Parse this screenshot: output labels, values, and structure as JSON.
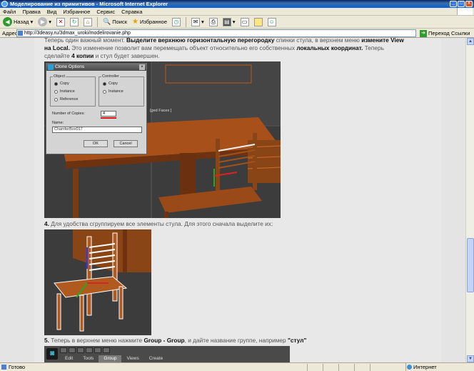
{
  "window": {
    "title": "Моделирование из примитивов - Microsoft Internet Explorer"
  },
  "menu": [
    "Файл",
    "Правка",
    "Вид",
    "Избранное",
    "Сервис",
    "Справка"
  ],
  "toolbar": {
    "back_label": "Назад",
    "search_label": "Поиск",
    "favorites_label": "Избранное"
  },
  "address": {
    "label": "Адрес:",
    "url": "http://3deasy.ru/3dmax_uroki/modelirovanie.php",
    "go_label": "Переход",
    "links_label": "Ссылки"
  },
  "article": {
    "p1_a": "Теперь один важный момент.",
    "p1_b": "Выделите верхнюю горизонтальную перегородку",
    "p1_c": "спинки стула, в верхнем меню",
    "p1_d": "измените View",
    "p2_a": "на Local.",
    "p2_b": "Это изменение позволит вам перемещать объект относительно его собственных",
    "p2_c": "локальных координат.",
    "p2_d": "Теперь",
    "p3_a": "сделайте",
    "p3_b": "4 копии",
    "p3_c": "и стул будет завершен.",
    "step4_num": "4.",
    "step4_text": "Для удобства сгруппируем все элементы стула. Для этого сначала выделите их:",
    "step5_num": "5.",
    "step5_a": "Теперь в верхнем меню нажмите",
    "step5_b": "Group - Group",
    "step5_c": ", и дайте название группе, например",
    "step5_d": "\"стул\""
  },
  "clone_dialog": {
    "title": "Clone Options",
    "object_label": "Object",
    "object_options": [
      "Copy",
      "Instance",
      "Reference"
    ],
    "controller_label": "Controller",
    "controller_options": [
      "Copy",
      "Instance"
    ],
    "copies_label": "Number of Copies:",
    "copies_value": "4",
    "name_label": "Name:",
    "name_value": "ChamferBox017",
    "ok_label": "OK",
    "cancel_label": "Cancel"
  },
  "viewport_label": "[ged Faces ]",
  "max_menu": [
    "Edit",
    "Tools",
    "Group",
    "Views",
    "Create"
  ],
  "max_menu_active": "Group",
  "status": {
    "left": "Готово",
    "zone": "Интернет"
  }
}
